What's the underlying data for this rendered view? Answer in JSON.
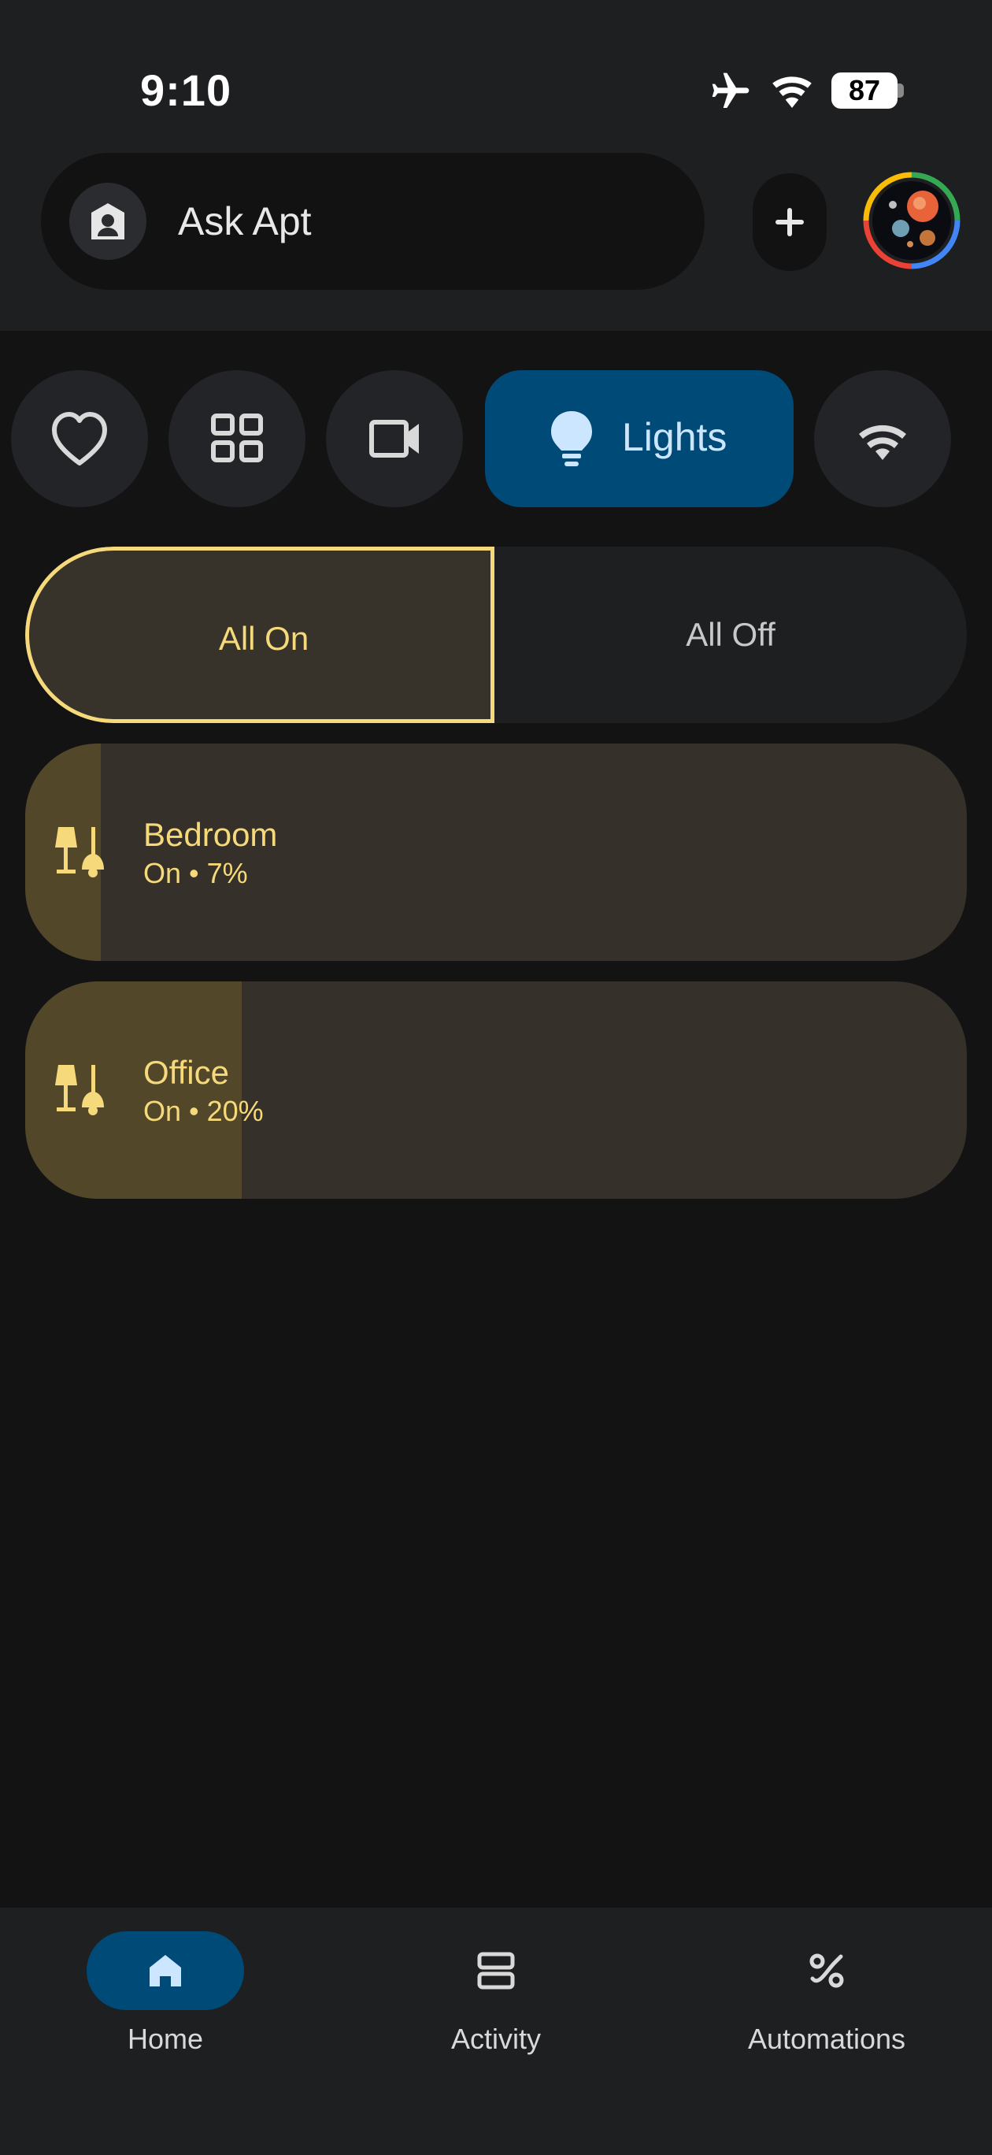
{
  "status_bar": {
    "time": "9:10",
    "battery_level": "87",
    "icons": [
      "airplane-icon",
      "wifi-icon",
      "battery-icon"
    ]
  },
  "header": {
    "search_label": "Ask Apt",
    "add_icon": "plus-icon",
    "avatar_icon": "profile-avatar"
  },
  "chips": [
    {
      "icon": "heart-icon",
      "label": ""
    },
    {
      "icon": "grid-icon",
      "label": ""
    },
    {
      "icon": "video-camera-icon",
      "label": ""
    },
    {
      "icon": "lightbulb-icon",
      "label": "Lights",
      "selected": true
    },
    {
      "icon": "wifi-icon",
      "label": ""
    }
  ],
  "toggle": {
    "on_label": "All On",
    "off_label": "All Off",
    "selected": "on"
  },
  "rooms": [
    {
      "name": "Bedroom",
      "status": "On • 7%",
      "brightness_percent": 7
    },
    {
      "name": "Office",
      "status": "On • 20%",
      "brightness_percent": 20
    }
  ],
  "nav": {
    "items": [
      {
        "label": "Home",
        "icon": "home-icon",
        "active": true
      },
      {
        "label": "Activity",
        "icon": "activity-icon",
        "active": false
      },
      {
        "label": "Automations",
        "icon": "automations-icon",
        "active": false
      }
    ]
  },
  "colors": {
    "background": "#131313",
    "surface": "#1e1f21",
    "accent_selected": "#004a77",
    "light_on_text": "#f5d97a",
    "tile_background": "#35312a",
    "tile_fill": "#53472a"
  }
}
